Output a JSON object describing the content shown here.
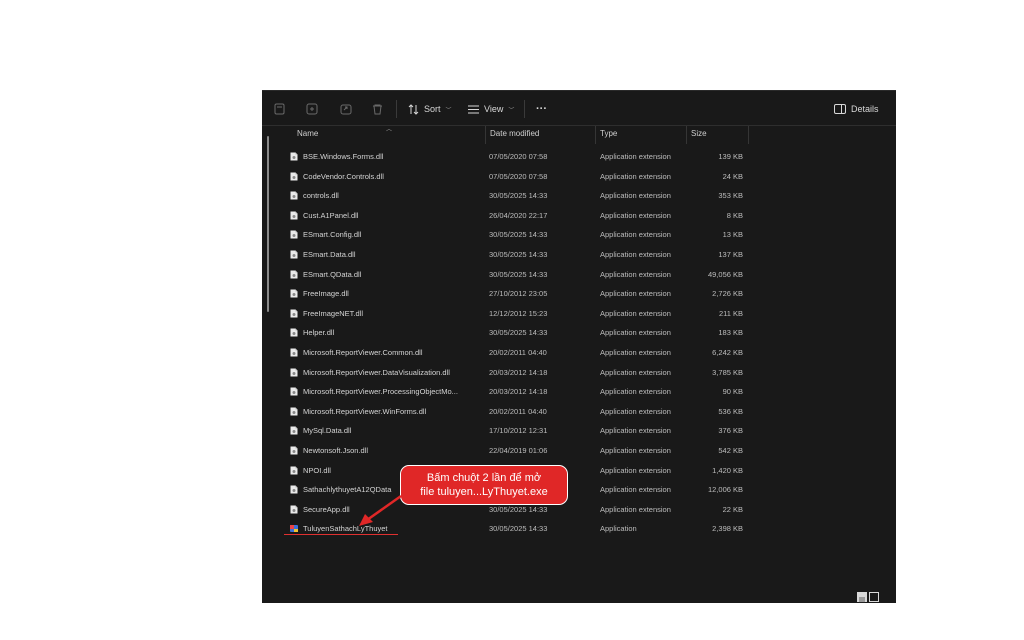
{
  "toolbar": {
    "sort_label": "Sort",
    "view_label": "View",
    "more_label": "···",
    "details_label": "Details"
  },
  "columns": {
    "name": "Name",
    "date": "Date modified",
    "type": "Type",
    "size": "Size"
  },
  "files": [
    {
      "name": "BSE.Windows.Forms.dll",
      "date": "07/05/2020 07:58",
      "type": "Application extension",
      "size": "139 KB"
    },
    {
      "name": "CodeVendor.Controls.dll",
      "date": "07/05/2020 07:58",
      "type": "Application extension",
      "size": "24 KB"
    },
    {
      "name": "controls.dll",
      "date": "30/05/2025 14:33",
      "type": "Application extension",
      "size": "353 KB"
    },
    {
      "name": "Cust.A1Panel.dll",
      "date": "26/04/2020 22:17",
      "type": "Application extension",
      "size": "8 KB"
    },
    {
      "name": "ESmart.Config.dll",
      "date": "30/05/2025 14:33",
      "type": "Application extension",
      "size": "13 KB"
    },
    {
      "name": "ESmart.Data.dll",
      "date": "30/05/2025 14:33",
      "type": "Application extension",
      "size": "137 KB"
    },
    {
      "name": "ESmart.QData.dll",
      "date": "30/05/2025 14:33",
      "type": "Application extension",
      "size": "49,056 KB"
    },
    {
      "name": "FreeImage.dll",
      "date": "27/10/2012 23:05",
      "type": "Application extension",
      "size": "2,726 KB"
    },
    {
      "name": "FreeImageNET.dll",
      "date": "12/12/2012 15:23",
      "type": "Application extension",
      "size": "211 KB"
    },
    {
      "name": "Helper.dll",
      "date": "30/05/2025 14:33",
      "type": "Application extension",
      "size": "183 KB"
    },
    {
      "name": "Microsoft.ReportViewer.Common.dll",
      "date": "20/02/2011 04:40",
      "type": "Application extension",
      "size": "6,242 KB"
    },
    {
      "name": "Microsoft.ReportViewer.DataVisualization.dll",
      "date": "20/03/2012 14:18",
      "type": "Application extension",
      "size": "3,785 KB"
    },
    {
      "name": "Microsoft.ReportViewer.ProcessingObjectMo...",
      "date": "20/03/2012 14:18",
      "type": "Application extension",
      "size": "90 KB"
    },
    {
      "name": "Microsoft.ReportViewer.WinForms.dll",
      "date": "20/02/2011 04:40",
      "type": "Application extension",
      "size": "536 KB"
    },
    {
      "name": "MySql.Data.dll",
      "date": "17/10/2012 12:31",
      "type": "Application extension",
      "size": "376 KB"
    },
    {
      "name": "Newtonsoft.Json.dll",
      "date": "22/04/2019 01:06",
      "type": "Application extension",
      "size": "542 KB"
    },
    {
      "name": "NPOI.dll",
      "date": "",
      "type": "Application extension",
      "size": "1,420 KB"
    },
    {
      "name": "SathachlythuyetA12QData",
      "date": "",
      "type": "Application extension",
      "size": "12,006 KB"
    },
    {
      "name": "SecureApp.dll",
      "date": "30/05/2025 14:33",
      "type": "Application extension",
      "size": "22 KB"
    },
    {
      "name": "TuluyenSathachLyThuyet",
      "date": "30/05/2025 14:33",
      "type": "Application",
      "size": "2,398 KB",
      "icon": "app-icon"
    }
  ],
  "callout": {
    "line1": "Bấm chuột 2 lần để mở",
    "line2": "file tuluyen...LyThuyet.exe"
  },
  "colors": {
    "background": "#191919",
    "callout": "#e02727",
    "text": "#d4d4d4"
  }
}
